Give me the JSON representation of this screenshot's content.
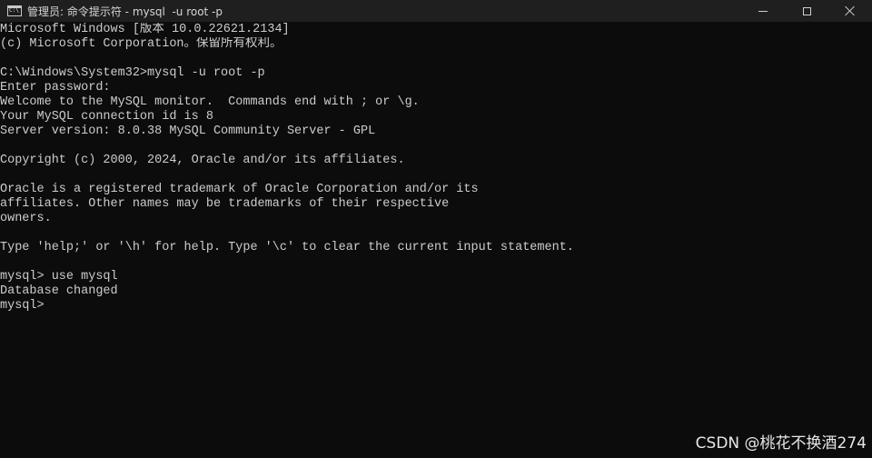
{
  "window": {
    "title": "管理员: 命令提示符 - mysql  -u root -p",
    "app_icon": "cmd-icon",
    "controls": {
      "minimize": "minimize-icon",
      "maximize": "maximize-icon",
      "close": "close-icon"
    }
  },
  "console": {
    "lines": [
      "Microsoft Windows [版本 10.0.22621.2134]",
      "(c) Microsoft Corporation。保留所有权利。",
      "",
      "C:\\Windows\\System32>mysql -u root -p",
      "Enter password:",
      "Welcome to the MySQL monitor.  Commands end with ; or \\g.",
      "Your MySQL connection id is 8",
      "Server version: 8.0.38 MySQL Community Server - GPL",
      "",
      "Copyright (c) 2000, 2024, Oracle and/or its affiliates.",
      "",
      "Oracle is a registered trademark of Oracle Corporation and/or its",
      "affiliates. Other names may be trademarks of their respective",
      "owners.",
      "",
      "Type 'help;' or '\\h' for help. Type '\\c' to clear the current input statement.",
      "",
      "mysql> use mysql",
      "Database changed"
    ],
    "prompt": "mysql> "
  },
  "watermark": "CSDN @桃花不换酒274",
  "colors": {
    "background": "#0c0c0c",
    "titlebar": "#1f1f1f",
    "text": "#cccccc"
  }
}
